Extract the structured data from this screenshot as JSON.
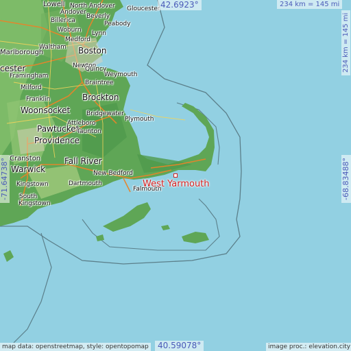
{
  "map": {
    "target": "West Yarmouth",
    "coords": {
      "top_lat": "42.6923°",
      "bottom_lat": "40.59078°",
      "left_lon": "-71.64738°",
      "right_lon": "-68.83488°"
    },
    "scale": {
      "top": "234 km = 145 mi",
      "right": "234 km = 145 mi"
    },
    "credits": {
      "left": "map data: openstreetmap, style: opentopomap",
      "right": "image proc.: elevation.city"
    },
    "places": {
      "lowell": "Lowell",
      "north_andover": "North Andover",
      "gloucester": "Gloucester",
      "andover": "Andover",
      "beverly": "Beverly",
      "peabody": "Peabody",
      "billerica": "Billerica",
      "woburn": "Woburn",
      "lynn": "Lynn",
      "medford": "Medford",
      "waltham": "Waltham",
      "boston": "Boston",
      "marlborough": "Marlborough",
      "newton": "Newton",
      "cester": "cester",
      "quincy": "Quincy",
      "framingham": "Framingham",
      "weymouth": "Weymouth",
      "braintree": "Braintree",
      "milford": "Milford",
      "franklin": "Franklin",
      "brockton": "Brockton",
      "woonsocket": "Woonsocket",
      "bridgewater": "Bridgewater",
      "plymouth": "Plymouth",
      "attleboro": "Attleboro",
      "pawtucket": "Pawtucket",
      "taunton": "Taunton",
      "providence": "Providence",
      "cranston": "Cranston",
      "fall_river": "Fall River",
      "warwick": "Warwick",
      "new_bedford": "New Bedford",
      "kingstown": "Kingstown",
      "dartmouth": "Dartmouth",
      "falmouth": "Falmouth",
      "south": "South",
      "kingstown2": "Kingstown"
    }
  }
}
